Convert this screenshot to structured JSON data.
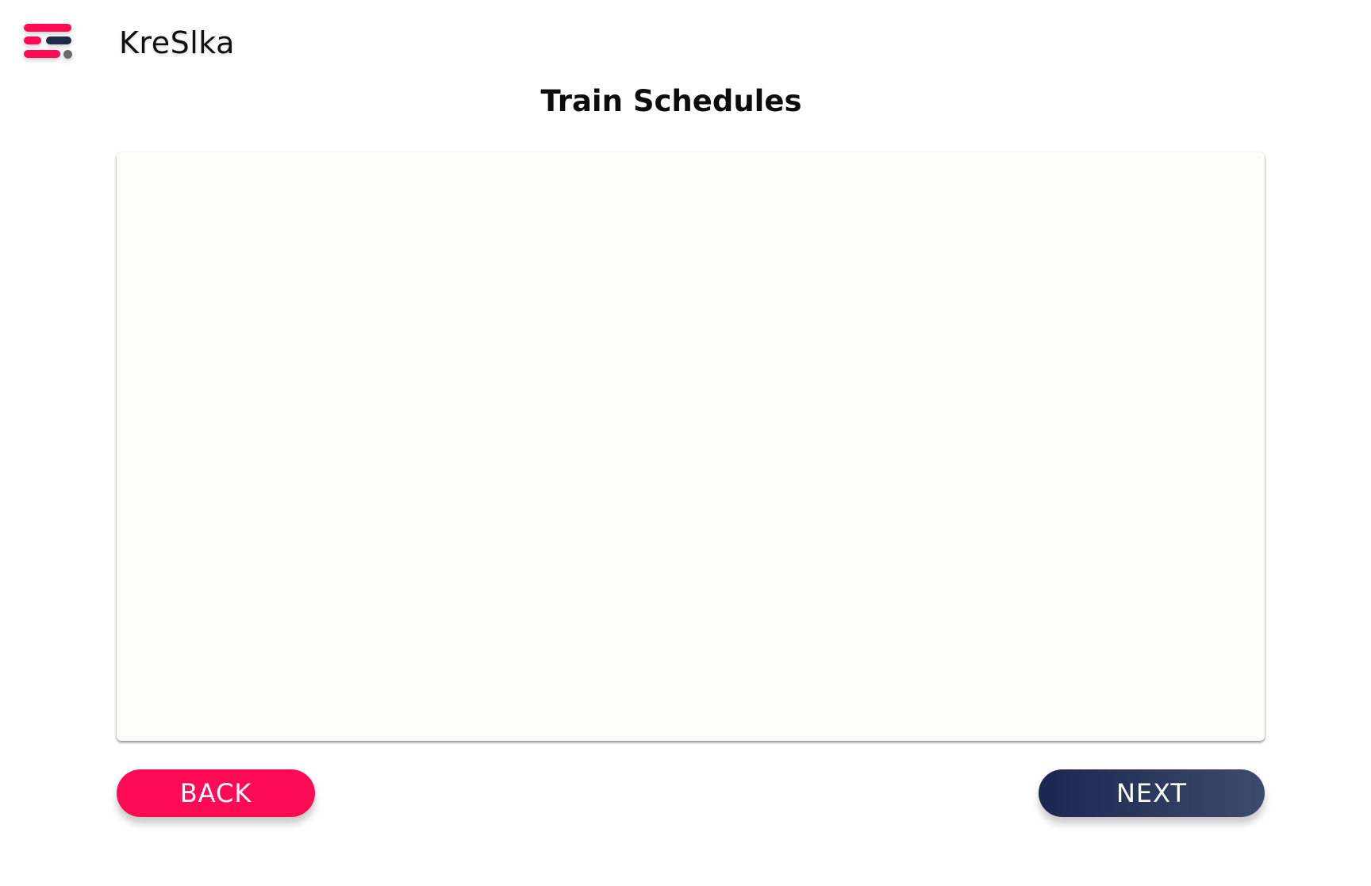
{
  "header": {
    "brand_name": "KreSlka",
    "logo_icon": "kreslka-logo-icon"
  },
  "page": {
    "title": "Train Schedules"
  },
  "navigation": {
    "back_label": "BACK",
    "next_label": "NEXT"
  },
  "colors": {
    "accent": "#ff0a55",
    "navy_start": "#1a2750",
    "navy_end": "#3d4b6c",
    "panel_background": "#fcfcfb"
  }
}
